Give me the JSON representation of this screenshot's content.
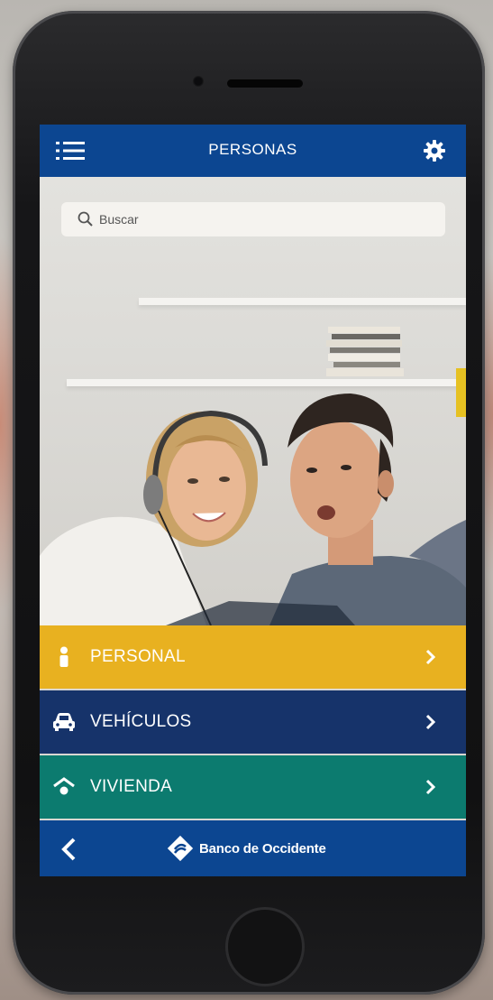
{
  "header": {
    "title": "PERSONAS",
    "menu_icon": "hamburger-menu-icon",
    "settings_icon": "gear-icon"
  },
  "search": {
    "placeholder": "Buscar",
    "icon": "search-icon"
  },
  "categories": [
    {
      "label": "PERSONAL",
      "icon": "person-icon",
      "color": "#e8ae12"
    },
    {
      "label": "VEHÍCULOS",
      "icon": "car-icon",
      "color": "#16336a"
    },
    {
      "label": "VIVIENDA",
      "icon": "house-icon",
      "color": "#0c7b6f"
    }
  ],
  "footer": {
    "back_icon": "chevron-left-icon",
    "brand": "Banco de Occidente",
    "logo_icon": "bank-logo-icon"
  },
  "colors": {
    "primary": "#0c4691",
    "personal": "#e8ae12",
    "vehiculos": "#16336a",
    "vivienda": "#0c7b6f"
  }
}
